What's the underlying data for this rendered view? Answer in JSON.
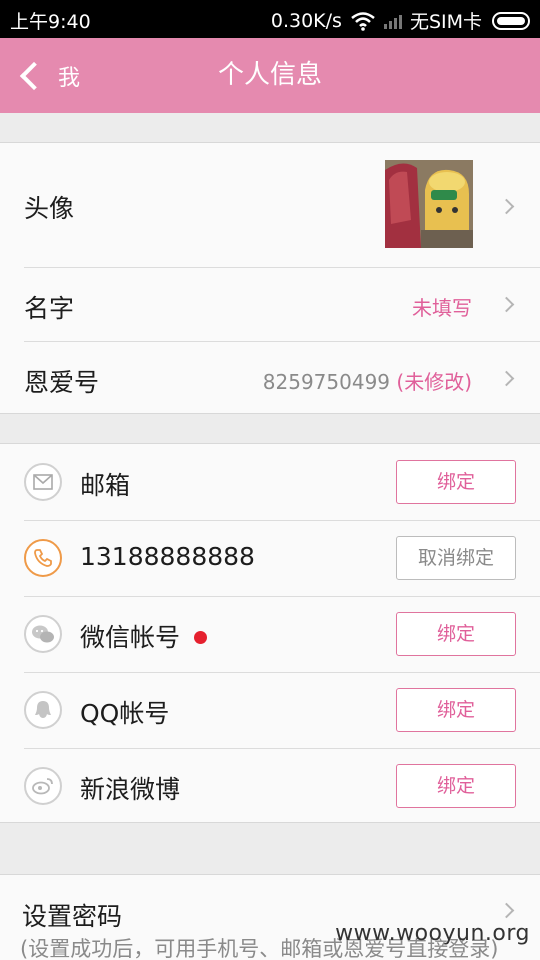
{
  "status_bar": {
    "time": "上午9:40",
    "speed": "0.30K/s",
    "sim": "无SIM卡"
  },
  "header": {
    "back_label": "我",
    "title": "个人信息"
  },
  "profile": {
    "avatar_label": "头像",
    "name_label": "名字",
    "name_value": "未填写",
    "id_label": "恩爱号",
    "id_number": "8259750499",
    "id_status": "(未修改)"
  },
  "accounts": [
    {
      "label": "邮箱",
      "button": "绑定",
      "icon": "mail-icon",
      "bound": false
    },
    {
      "label": "13188888888",
      "button": "取消绑定",
      "icon": "phone-icon",
      "bound": true
    },
    {
      "label": "微信帐号",
      "button": "绑定",
      "icon": "wechat-icon",
      "bound": false,
      "has_dot": true
    },
    {
      "label": "QQ帐号",
      "button": "绑定",
      "icon": "qq-icon",
      "bound": false
    },
    {
      "label": "新浪微博",
      "button": "绑定",
      "icon": "weibo-icon",
      "bound": false
    }
  ],
  "password": {
    "label": "设置密码",
    "hint": "(设置成功后，可用手机号、邮箱或恩爱号直接登录)"
  },
  "watermark": "www.wooyun.org",
  "colors": {
    "header": "#e58aaf",
    "accent": "#e0609a",
    "dot": "#e5202e"
  }
}
